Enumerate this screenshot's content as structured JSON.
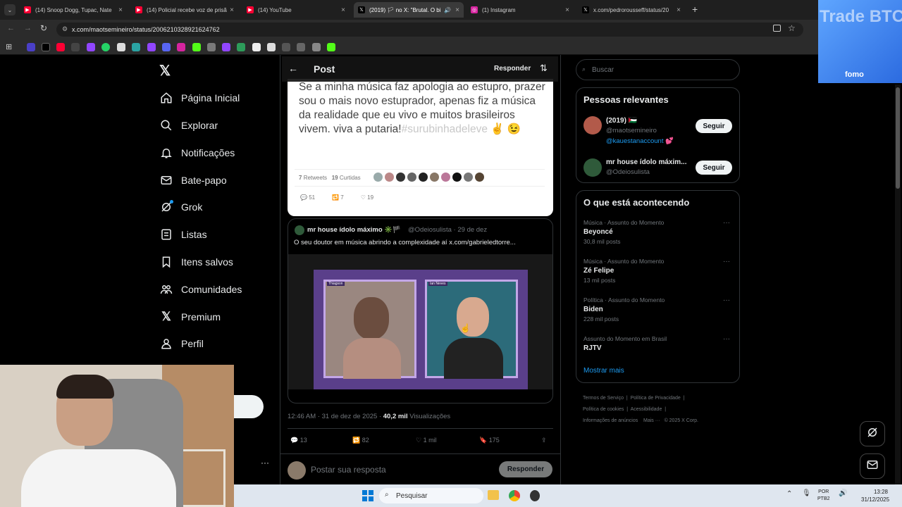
{
  "browser": {
    "tabs": [
      {
        "label": "(14) Snoop Dogg, Tupac, Nate",
        "fav_color": "#ff0033"
      },
      {
        "label": "(14) Policial recebe voz de prisã",
        "fav_color": "#ff0033"
      },
      {
        "label": "(14) YouTube",
        "fav_color": "#ff0033"
      },
      {
        "label": "(2019) 🏳 no X: \"Brutal. O bi",
        "fav_color": "#000000"
      },
      {
        "label": "(1) Instagram",
        "fav_color": "#d6249f"
      },
      {
        "label": "x.com/pedrorousseff/status/20",
        "fav_color": "#000000"
      }
    ],
    "new_tab": "+",
    "url": "x.com/maotsemineiro/status/2006210328921624762"
  },
  "nav": {
    "items": [
      {
        "label": "Página Inicial",
        "icon": "home-icon"
      },
      {
        "label": "Explorar",
        "icon": "search-icon"
      },
      {
        "label": "Notificações",
        "icon": "bell-icon"
      },
      {
        "label": "Bate-papo",
        "icon": "mail-icon"
      },
      {
        "label": "Grok",
        "icon": "grok-icon"
      },
      {
        "label": "Listas",
        "icon": "list-icon"
      },
      {
        "label": "Itens salvos",
        "icon": "bookmark-icon"
      },
      {
        "label": "Comunidades",
        "icon": "communities-icon"
      },
      {
        "label": "Premium",
        "icon": "x-logo-icon"
      },
      {
        "label": "Perfil",
        "icon": "profile-icon"
      }
    ],
    "more": "···"
  },
  "post": {
    "header_title": "Post",
    "reply_label": "Responder",
    "quoted_text_1": "Se a minha música faz apologia ao estupro, prazer sou o mais novo estuprador, apenas fiz a música da realidade que eu vivo e muitos brasileiros vivem. viva a putaria!",
    "quoted_hashtag": "#surubinhadeleve",
    "quoted_emoji": "✌️ 😉",
    "quoted_retweets": "7",
    "quoted_retweets_label": "Retweets",
    "quoted_likes": "19",
    "quoted_likes_label": "Curtidas",
    "quoted_replies_count": "51",
    "quoted_rt_count": "7",
    "quoted_heart_count": "19",
    "quote2_author": "mr house ídolo máximo ✳️🏴",
    "quote2_handle": "@Odeiosulista · 29 de dez",
    "quote2_text": "O seu doutor em música abrindo a complexidade aí  x.com/gabrieledtorre...",
    "video_name_left": "Thiagson",
    "video_name_right": "Ian Neves",
    "timestamp": "12:46 AM · 31 de dez de 2025 · ",
    "views_count": "40,2 mil",
    "views_label": " Visualizações",
    "stats": {
      "replies": "13",
      "reposts": "82",
      "likes": "1 mil",
      "bookmarks": "175"
    },
    "reply_placeholder": "Postar sua resposta",
    "reply_button": "Responder"
  },
  "sidebar": {
    "search_placeholder": "Buscar",
    "relevant_title": "Pessoas relevantes",
    "people": [
      {
        "name": "(2019) 🇵🇸",
        "handle": "@maotsemineiro",
        "bio": "@kauestanaccount 💕",
        "button": "Seguir"
      },
      {
        "name": "mr house ídolo máxim...",
        "handle": "@Odeiosulista",
        "bio": "",
        "button": "Seguir"
      }
    ],
    "trends_title": "O que está acontecendo",
    "trends": [
      {
        "meta": "Música · Assunto do Momento",
        "name": "Beyoncé",
        "count": "30,8 mil posts"
      },
      {
        "meta": "Música · Assunto do Momento",
        "name": "Zé Felipe",
        "count": "13 mil posts"
      },
      {
        "meta": "Política · Assunto do Momento",
        "name": "Biden",
        "count": "228 mil posts"
      },
      {
        "meta": "Assunto do Momento em Brasil",
        "name": "RJTV",
        "count": ""
      }
    ],
    "show_more": "Mostrar mais",
    "footer": [
      "Termos de Serviço",
      "Política de Privacidade",
      "Política de cookies",
      "Acessibilidade",
      "Informações de anúncios",
      "Mais ···",
      "© 2025 X Corp."
    ]
  },
  "overlay": {
    "ad_text": "Trade BTC",
    "ad_brand": "fomo"
  },
  "taskbar": {
    "search_placeholder": "Pesquisar",
    "lang": "POR",
    "lang2": "PTB2",
    "time": "13:28",
    "date": "31/12/2025"
  },
  "colors": {
    "accent": "#1d9bf0",
    "background": "#000000",
    "border": "#2f3336"
  }
}
